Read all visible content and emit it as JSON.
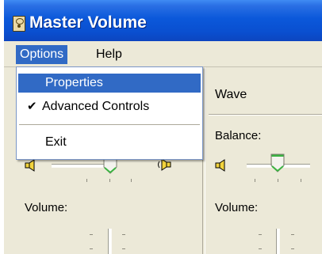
{
  "window": {
    "title": "Master Volume"
  },
  "menubar": {
    "options_label": "Options",
    "help_label": "Help"
  },
  "dropdown": {
    "items": [
      {
        "label": "Properties",
        "checked": false,
        "selected": true
      },
      {
        "label": "Advanced Controls",
        "checked": true,
        "selected": false
      },
      {
        "label": "Exit",
        "checked": false,
        "selected": false
      }
    ],
    "check_glyph": "✔"
  },
  "panels": {
    "left": {
      "volume_label": "Volume:"
    },
    "wave": {
      "title": "Wave",
      "balance_label": "Balance:",
      "volume_label": "Volume:"
    }
  },
  "colors": {
    "titlebar": "#0b58da",
    "highlight": "#316ac5",
    "face": "#ece9d8",
    "thumb_accent": "#3bb241"
  }
}
